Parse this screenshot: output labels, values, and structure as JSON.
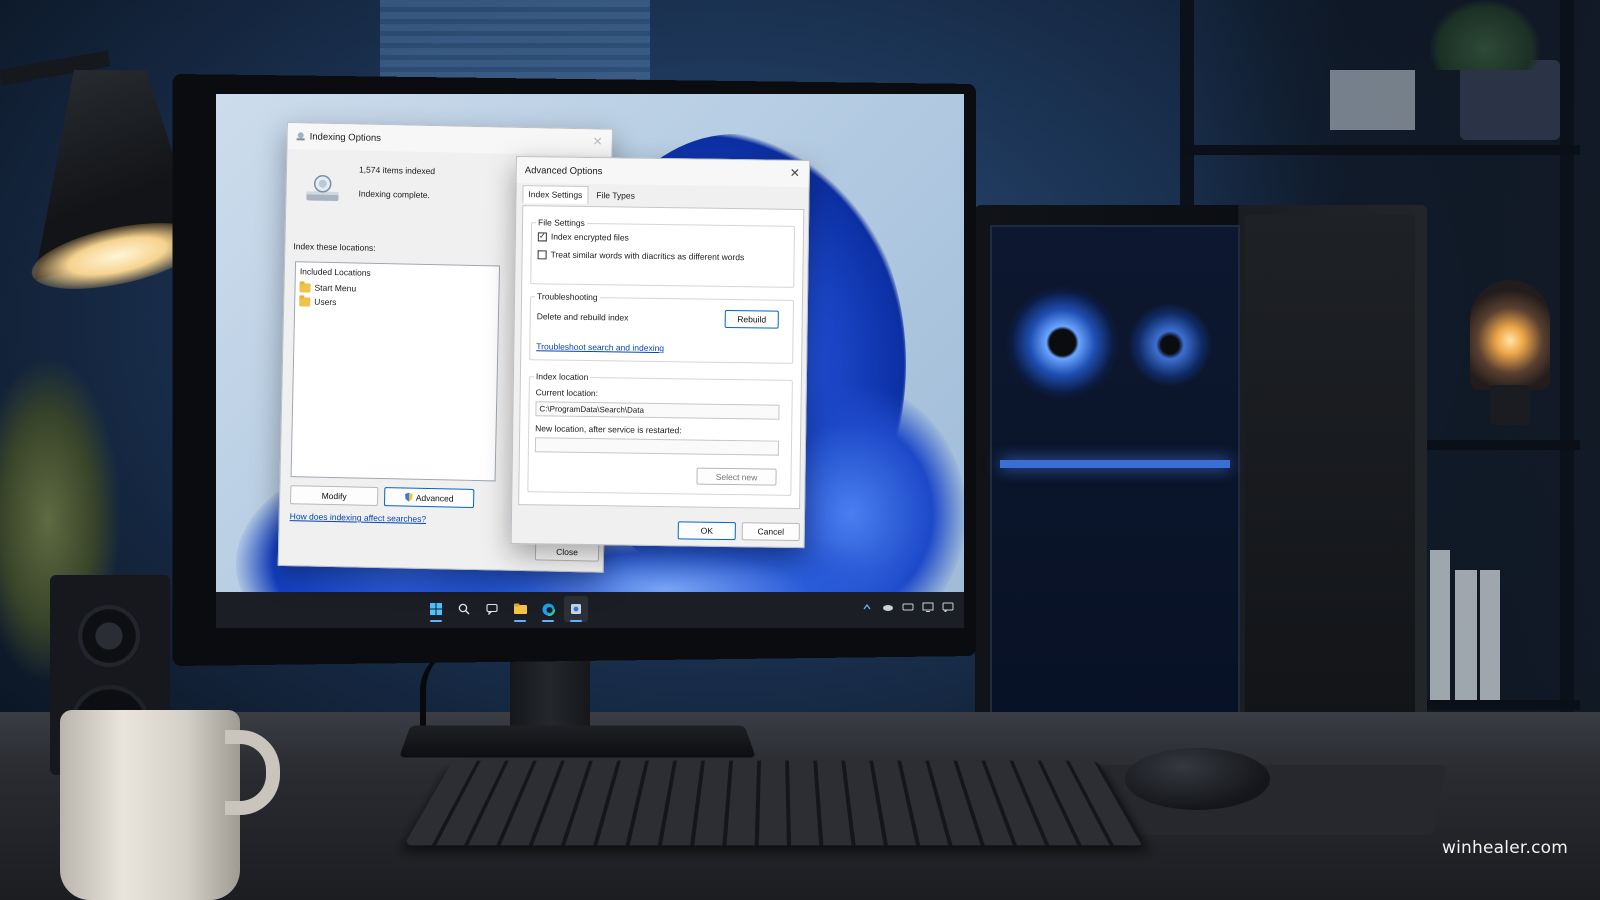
{
  "indexing_dialog": {
    "title": "Indexing Options",
    "items_indexed": "1,574 items indexed",
    "status": "Indexing complete.",
    "locations_label": "Index these locations:",
    "list_header": "Included Locations",
    "locations": [
      {
        "label": "Start Menu",
        "icon": "folder-icon"
      },
      {
        "label": "Users",
        "icon": "folder-icon"
      }
    ],
    "modify_label": "Modify",
    "advanced_label": "Advanced",
    "help_link": "How does indexing affect searches?",
    "close_label": "Close"
  },
  "advanced_dialog": {
    "title": "Advanced Options",
    "tabs": [
      {
        "label": "Index Settings",
        "selected": true
      },
      {
        "label": "File Types",
        "selected": false
      }
    ],
    "file_settings": {
      "title": "File Settings",
      "encrypted_label": "Index encrypted files",
      "encrypted_checked": true,
      "diacritics_label": "Treat similar words with diacritics as different words",
      "diacritics_checked": false
    },
    "troubleshooting": {
      "title": "Troubleshooting",
      "rebuild_text": "Delete and rebuild index",
      "rebuild_label": "Rebuild",
      "link": "Troubleshoot search and indexing"
    },
    "index_location": {
      "title": "Index location",
      "current_label": "Current location:",
      "current_value": "C:\\ProgramData\\Search\\Data",
      "new_label": "New location, after service is restarted:",
      "new_value": "",
      "select_new_label": "Select new"
    },
    "ok_label": "OK",
    "cancel_label": "Cancel"
  },
  "taskbar": {
    "icons": [
      "windows-start-icon",
      "search-icon",
      "chat-icon",
      "file-explorer-icon",
      "edge-icon",
      "indexing-app-icon"
    ],
    "tray_icons": [
      "chevron-up-icon",
      "onedrive-icon",
      "network-icon",
      "display-icon",
      "notification-icon"
    ]
  },
  "watermark": "winhealer.com",
  "colors": {
    "accent": "#0067c0",
    "link": "#0645ad",
    "taskbar": "#1b1e24",
    "wallpaper_bloom": "#1e4bd0"
  }
}
